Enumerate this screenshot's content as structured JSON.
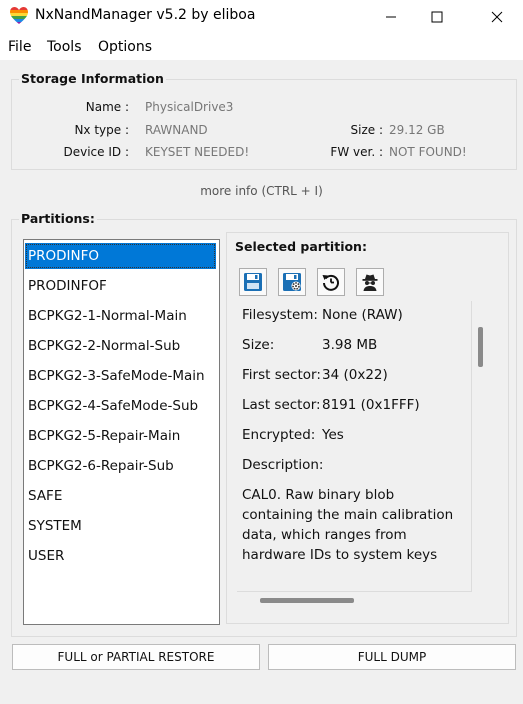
{
  "window": {
    "title": "NxNandManager v5.2 by eliboa"
  },
  "menu": [
    "File",
    "Tools",
    "Options"
  ],
  "storage": {
    "title": "Storage Information",
    "name_label": "Name :",
    "name_value": "PhysicalDrive3",
    "nxtype_label": "Nx type :",
    "nxtype_value": "RAWNAND",
    "size_label": "Size :",
    "size_value": "29.12 GB",
    "deviceid_label": "Device ID :",
    "deviceid_value": "KEYSET NEEDED!",
    "fwver_label": "FW ver. :",
    "fwver_value": "NOT FOUND!",
    "more_info": "more info (CTRL + I)"
  },
  "partitions": {
    "title": "Partitions:",
    "selected_index": 0,
    "items": [
      "PRODINFO",
      "PRODINFOF",
      "BCPKG2-1-Normal-Main",
      "BCPKG2-2-Normal-Sub",
      "BCPKG2-3-SafeMode-Main",
      "BCPKG2-4-SafeMode-Sub",
      "BCPKG2-5-Repair-Main",
      "BCPKG2-6-Repair-Sub",
      "SAFE",
      "SYSTEM",
      "USER"
    ]
  },
  "selected": {
    "title": "Selected partition:",
    "toolbar_icons": [
      "save-icon",
      "save-settings-icon",
      "restore-icon",
      "spy-icon"
    ],
    "filesystem_label": "Filesystem:",
    "filesystem_value": "None (RAW)",
    "size_label": "Size:",
    "size_value": "3.98 MB",
    "first_sector_label": "First sector:",
    "first_sector_value": "34 (0x22)",
    "last_sector_label": "Last sector:",
    "last_sector_value": "8191 (0x1FFF)",
    "encrypted_label": "Encrypted:",
    "encrypted_value": "Yes",
    "description_label": "Description:",
    "description_value": "CAL0. Raw binary blob containing the main calibration data, which ranges from hardware IDs to system keys"
  },
  "buttons": {
    "restore": "FULL or PARTIAL RESTORE",
    "dump": "FULL DUMP"
  },
  "colors": {
    "selection": "#0078d7",
    "panel_bg": "#f0f0f0",
    "save_icon": "#1a6fb5"
  }
}
